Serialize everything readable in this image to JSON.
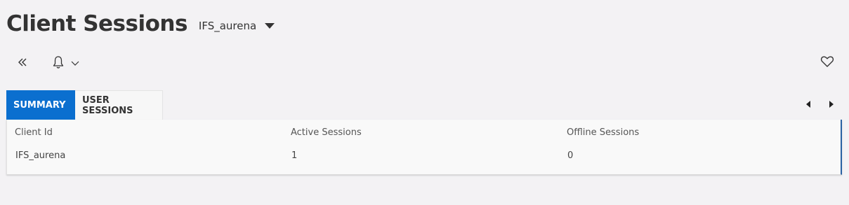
{
  "header": {
    "title": "Client Sessions",
    "context": "IFS_aurena"
  },
  "toolbar": {
    "back_icon": "double-chevron-left-icon",
    "notify_icon": "bell-icon",
    "favorite_icon": "heart-icon"
  },
  "tabs": [
    {
      "label": "SUMMARY",
      "active": true
    },
    {
      "label": "USER SESSIONS",
      "active": false
    }
  ],
  "summary": {
    "columns": [
      {
        "label": "Client Id",
        "value": "IFS_aurena"
      },
      {
        "label": "Active Sessions",
        "value": "1"
      },
      {
        "label": "Offline Sessions",
        "value": "0"
      }
    ]
  },
  "colors": {
    "background": "#f3f2f4",
    "accent": "#0b6fcf",
    "panel_border": "#2a62a3"
  }
}
